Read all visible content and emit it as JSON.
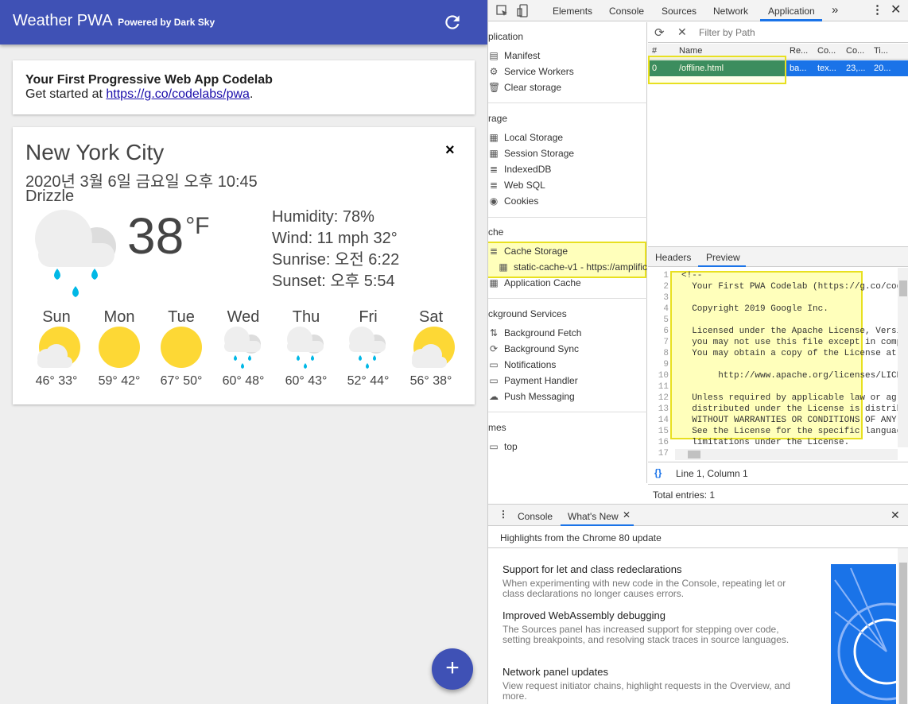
{
  "app": {
    "title": "Weather PWA",
    "subtitle": "Powered by Dark Sky",
    "intro_title": "Your First Progressive Web App Codelab",
    "intro_text": "Get started at ",
    "intro_link": "https://g.co/codelabs/pwa",
    "intro_end": ".",
    "city": "New York City",
    "date": "2020년 3월 6일 금요일 오후 10:45",
    "description": "Drizzle",
    "temperature": "38",
    "unit": "°F",
    "humidity": "Humidity: 78%",
    "wind": "Wind: 11 mph 32°",
    "sunrise": "Sunrise: 오전 6:22",
    "sunset": "Sunset: 오후 5:54",
    "forecast": [
      {
        "day": "Sun",
        "temps": "46° 33°",
        "icon": "partly-cloudy-icon"
      },
      {
        "day": "Mon",
        "temps": "59° 42°",
        "icon": "clear-day-icon"
      },
      {
        "day": "Tue",
        "temps": "67° 50°",
        "icon": "clear-day-icon"
      },
      {
        "day": "Wed",
        "temps": "60° 48°",
        "icon": "rain-icon"
      },
      {
        "day": "Thu",
        "temps": "60° 43°",
        "icon": "rain-icon"
      },
      {
        "day": "Fri",
        "temps": "52° 44°",
        "icon": "rain-icon"
      },
      {
        "day": "Sat",
        "temps": "56° 38°",
        "icon": "partly-cloudy-icon"
      }
    ],
    "fab": "+",
    "close": "×"
  },
  "devtools": {
    "tabs": [
      "Elements",
      "Console",
      "Sources",
      "Network",
      "Application"
    ],
    "more": "»",
    "sections": {
      "application": "plication",
      "storage": "rage",
      "cache": "che",
      "background": "ckground Services",
      "frames": "mes"
    },
    "app_items": [
      "Manifest",
      "Service Workers",
      "Clear storage"
    ],
    "storage_items": [
      "Local Storage",
      "Session Storage",
      "IndexedDB",
      "Web SQL",
      "Cookies"
    ],
    "cache_items": [
      "Cache Storage",
      "static-cache-v1 - https://amplific",
      "Application Cache"
    ],
    "bg_items": [
      "Background Fetch",
      "Background Sync",
      "Notifications",
      "Payment Handler",
      "Push Messaging"
    ],
    "frame_items": [
      "top"
    ],
    "filter_placeholder": "Filter by Path",
    "columns": [
      "#",
      "Name",
      "Re...",
      "Co...",
      "Co...",
      "Ti..."
    ],
    "row": [
      "0",
      "/offline.html",
      "ba...",
      "tex...",
      "23,...",
      "20..."
    ],
    "preview_tabs": [
      "Headers",
      "Preview"
    ],
    "code_lines": [
      "<!--",
      "  Your First PWA Codelab (https://g.co/code",
      "",
      "  Copyright 2019 Google Inc.",
      "",
      "  Licensed under the Apache License, Versio",
      "  you may not use this file except in compl",
      "  You may obtain a copy of the License at",
      "",
      "       http://www.apache.org/licenses/LICEN",
      "",
      "  Unless required by applicable law or agre",
      "  distributed under the License is distribu",
      "  WITHOUT WARRANTIES OR CONDITIONS OF ANY K",
      "  See the License for the specific language",
      "  limitations under the License.",
      ""
    ],
    "status": "Line 1, Column 1",
    "pretty": "{}",
    "total": "Total entries: 1",
    "drawer_tabs": [
      "Console",
      "What's New"
    ],
    "drawer_heading": "Highlights from the Chrome 80 update",
    "news": [
      {
        "title": "Support for let and class redeclarations",
        "desc": "When experimenting with new code in the Console, repeating let or class declarations no longer causes errors."
      },
      {
        "title": "Improved WebAssembly debugging",
        "desc": "The Sources panel has increased support for stepping over code, setting breakpoints, and resolving stack traces in source languages."
      },
      {
        "title": "Network panel updates",
        "desc": "View request initiator chains, highlight requests in the Overview, and more."
      }
    ]
  }
}
